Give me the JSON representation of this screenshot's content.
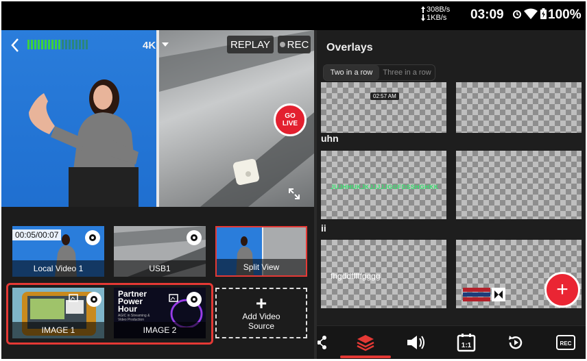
{
  "status_bar": {
    "upload_rate": "308B/s",
    "download_rate": "1KB/s",
    "time": "03:09",
    "battery": "100%",
    "icons": [
      "alarm-icon",
      "wifi-icon",
      "battery-icon"
    ]
  },
  "preview": {
    "resolution": "4K",
    "replay_label": "REPLAY",
    "rec_label": "REC",
    "go_live_line1": "GO",
    "go_live_line2": "LIVE",
    "level_meter_fraction": 0.55
  },
  "sources": {
    "local_video": {
      "label": "Local Video 1",
      "timecode": "00:05/00:07"
    },
    "usb": {
      "label": "USB1"
    },
    "split_view": {
      "label": "Split View"
    },
    "image1": {
      "label": "IMAGE 1"
    },
    "image2": {
      "label": "IMAGE 2",
      "poster_line1": "Partner",
      "poster_line2": "Power",
      "poster_line3": "Hour",
      "poster_small": "AGIC in Streaming & Video Production"
    },
    "add_video": {
      "line1": "Add Video",
      "line2": "Source"
    }
  },
  "overlays": {
    "title": "Overlays",
    "tabs": [
      {
        "label": "Two in a row",
        "active": true
      },
      {
        "label": "Three in a row",
        "active": false
      }
    ],
    "group1_time_badge": "02:57 AM",
    "caption_uhn": "uhn",
    "green_marquee": "JUJHHUKJKJJJJJGGFDSSHGHKK",
    "caption_ii": "ii",
    "text_overlay": "fhgddfffffgggg"
  },
  "colors": {
    "accent": "#e53935",
    "live": "#e3202f",
    "preview_bg": "#2a7ddb"
  }
}
